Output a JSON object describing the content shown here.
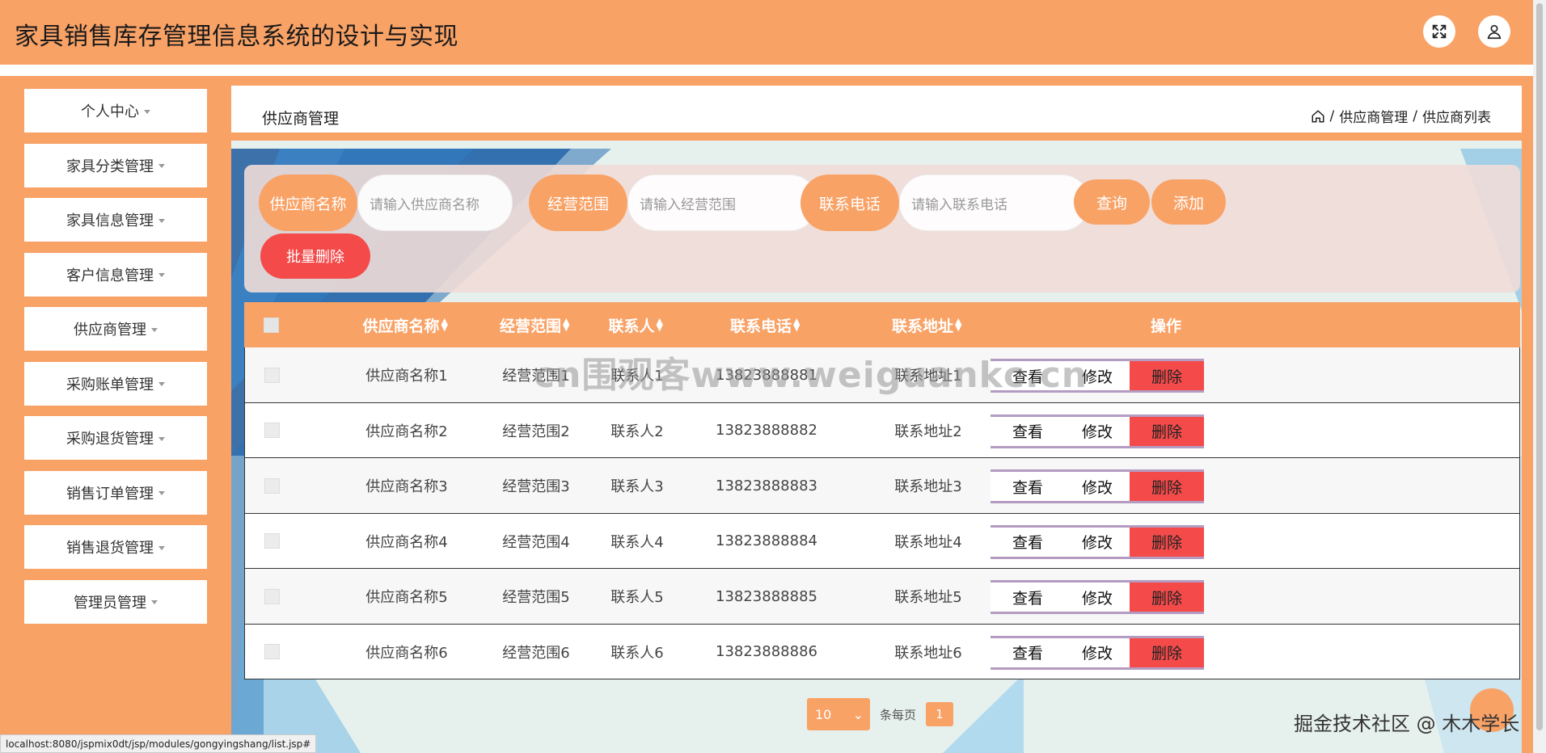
{
  "app": {
    "title": "家具销售库存管理信息系统的设计与实现"
  },
  "header": {
    "fullscreen_icon": "fullscreen-icon",
    "user_icon": "user-icon"
  },
  "sidebar": {
    "items": [
      {
        "label": "个人中心"
      },
      {
        "label": "家具分类管理"
      },
      {
        "label": "家具信息管理"
      },
      {
        "label": "客户信息管理"
      },
      {
        "label": "供应商管理"
      },
      {
        "label": "采购账单管理"
      },
      {
        "label": "采购退货管理"
      },
      {
        "label": "销售订单管理"
      },
      {
        "label": "销售退货管理"
      },
      {
        "label": "管理员管理"
      }
    ]
  },
  "page": {
    "title": "供应商管理",
    "breadcrumb": [
      "供应商管理",
      "供应商列表"
    ],
    "breadcrumb_sep": "/"
  },
  "search": {
    "name_label": "供应商名称",
    "name_placeholder": "请输入供应商名称",
    "scope_label": "经营范围",
    "scope_placeholder": "请输入经营范围",
    "phone_label": "联系电话",
    "phone_placeholder": "请输入联系电话",
    "query_button": "查询",
    "add_button": "添加",
    "batch_delete_button": "批量删除"
  },
  "table": {
    "headers": {
      "name": "供应商名称",
      "scope": "经营范围",
      "contact": "联系人",
      "phone": "联系电话",
      "address": "联系地址",
      "actions": "操作"
    },
    "sort_icon": "sort-icon",
    "rows": [
      {
        "name": "供应商名称1",
        "scope": "经营范围1",
        "contact": "联系人1",
        "phone": "13823888881",
        "address": "联系地址1"
      },
      {
        "name": "供应商名称2",
        "scope": "经营范围2",
        "contact": "联系人2",
        "phone": "13823888882",
        "address": "联系地址2"
      },
      {
        "name": "供应商名称3",
        "scope": "经营范围3",
        "contact": "联系人3",
        "phone": "13823888883",
        "address": "联系地址3"
      },
      {
        "name": "供应商名称4",
        "scope": "经营范围4",
        "contact": "联系人4",
        "phone": "13823888884",
        "address": "联系地址4"
      },
      {
        "name": "供应商名称5",
        "scope": "经营范围5",
        "contact": "联系人5",
        "phone": "13823888885",
        "address": "联系地址5"
      },
      {
        "name": "供应商名称6",
        "scope": "经营范围6",
        "contact": "联系人6",
        "phone": "13823888886",
        "address": "联系地址6"
      }
    ],
    "actions": {
      "view": "查看",
      "edit": "修改",
      "delete": "删除"
    }
  },
  "pager": {
    "page_size": "10",
    "per_page_label": "条每页",
    "current_page": "1"
  },
  "overlay": {
    "watermark": "cn围观客www.weiguankc.cn",
    "credit": "掘金技术社区 @ 木木学长",
    "status_url": "localhost:8080/jspmix0dt/jsp/modules/gongyingshang/list.jsp#"
  },
  "colors": {
    "primary": "#f9a266",
    "danger": "#f44a4a",
    "accent_border": "#b49bc1"
  }
}
